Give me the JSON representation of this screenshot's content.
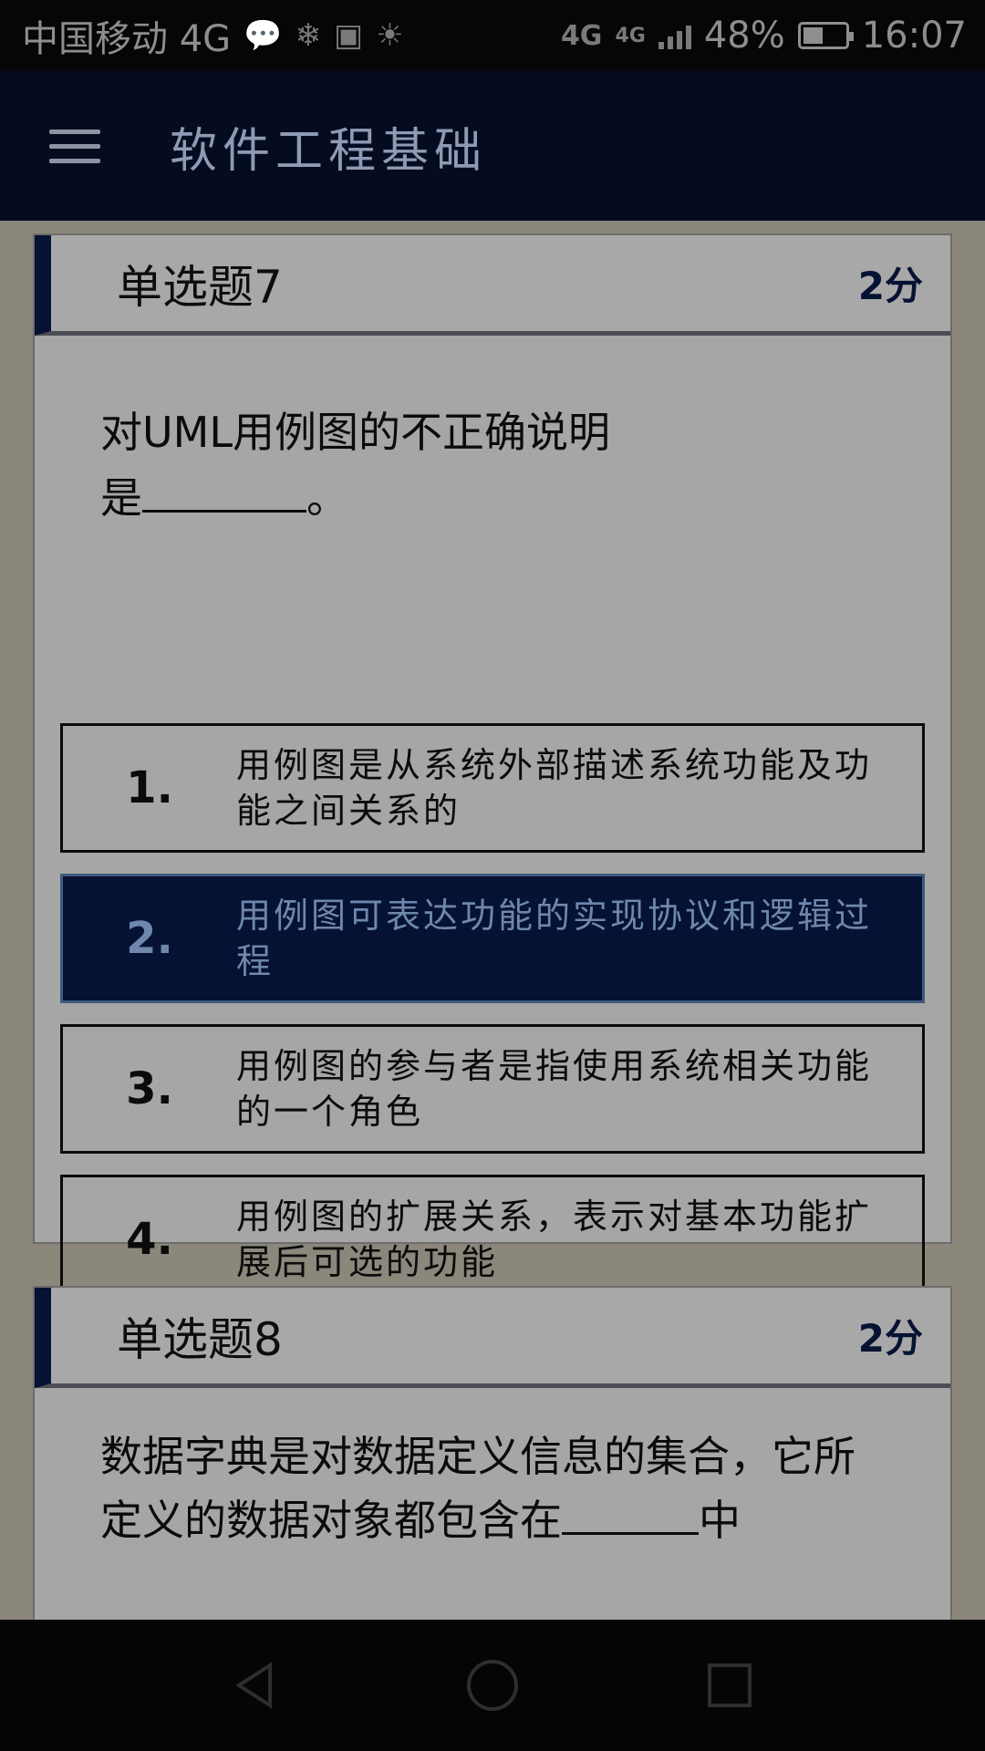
{
  "status_bar": {
    "carrier": "中国移动 4G",
    "network_1": "4G",
    "network_2": "4G",
    "battery": "48%",
    "battery_level": 0.48,
    "time": "16:07"
  },
  "app_bar": {
    "title": "软件工程基础"
  },
  "question7": {
    "title": "单选题7",
    "score": "2分",
    "text_line1": "对UML用例图的不正确说明",
    "text_line2_prefix": "是",
    "text_line2_suffix": "。",
    "options": [
      {
        "num": "1.",
        "text": "用例图是从系统外部描述系统功能及功能之间关系的"
      },
      {
        "num": "2.",
        "text": "用例图可表达功能的实现协议和逻辑过程"
      },
      {
        "num": "3.",
        "text": "用例图的参与者是指使用系统相关功能的一个角色"
      },
      {
        "num": "4.",
        "text": "用例图的扩展关系，表示对基本功能扩展后可选的功能"
      }
    ],
    "selected_option": 2
  },
  "question8": {
    "title": "单选题8",
    "score": "2分",
    "text": "数据字典是对数据定义信息的集合，它所定义的数据对象都包含在",
    "text_tail": "中"
  },
  "nav": {
    "back_icon": "back-triangle-icon",
    "home_icon": "home-circle-icon",
    "recents_icon": "recents-square-icon"
  }
}
